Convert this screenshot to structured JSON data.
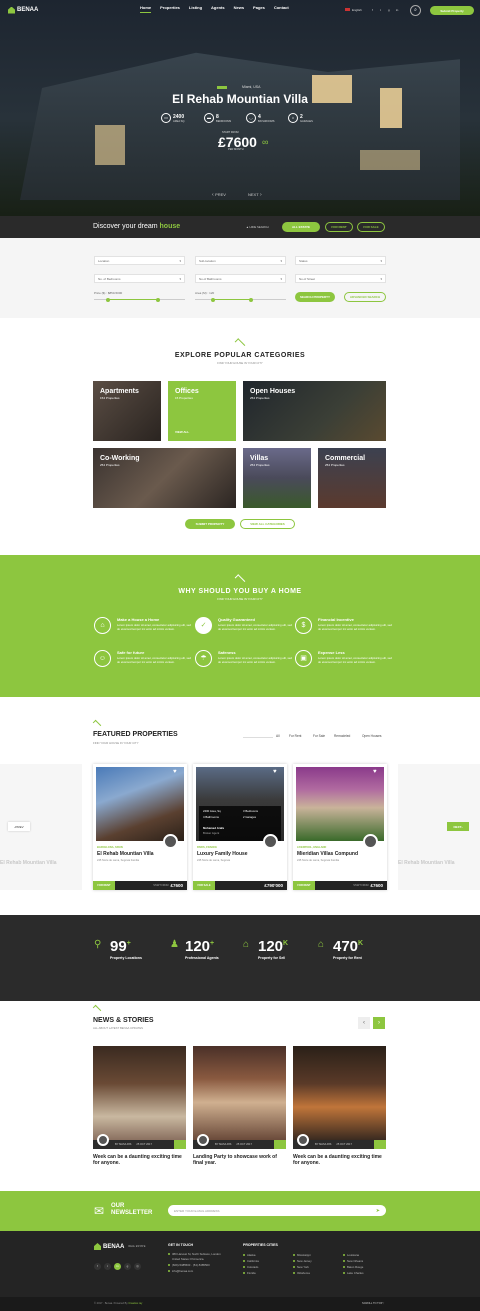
{
  "brand": {
    "name": "BENAA",
    "tagline": "REAL ESTATE"
  },
  "nav": {
    "items": [
      "Home",
      "Properties",
      "Listing",
      "Agents",
      "News",
      "Pages",
      "Contact"
    ],
    "language": "English",
    "submit": "Submit Property"
  },
  "hero": {
    "location": "Miami, USA",
    "title": "El Rehab Mountian Villa",
    "stats": [
      {
        "value": "2400",
        "label": "AREA SQ."
      },
      {
        "value": "8",
        "label": "BEDROOMS"
      },
      {
        "value": "4",
        "label": "BATHROOMS"
      },
      {
        "value": "2",
        "label": "GARAGES"
      }
    ],
    "from_label": "START FROM",
    "price": "£7600",
    "per": "PER MONTH",
    "prev": "PREV",
    "next": "NEXT"
  },
  "discover": {
    "text": "Discover your dream ",
    "highlight": "house",
    "hide": "HIDE SEARCH",
    "buttons": [
      "ALL ESTATE",
      "FOR RENT",
      "FOR SALE"
    ]
  },
  "search": {
    "fields": [
      "Location",
      "Sub-location",
      "Status",
      "No. of Bedrooms",
      "No.of Bathrooms",
      "No.of Street"
    ],
    "price_label": "Price ($) : $850-5000",
    "area_label": "Area (M) : 120",
    "search_btn": "SEARCH PROPERTY",
    "advanced_btn": "ADVANCED SEARCH"
  },
  "categories": {
    "title": "EXPLORE POPULAR CATEGORIES",
    "subtitle": "FIND YOUR HOUSE IN YOUR CITY",
    "items": [
      {
        "name": "Apartments",
        "count": "154 Properties"
      },
      {
        "name": "Offices",
        "count": "15 Properties",
        "more": "VIEW ALL"
      },
      {
        "name": "Open Houses",
        "count": "254 Properties"
      },
      {
        "name": "Co-Working",
        "count": "254 Properties"
      },
      {
        "name": "Villas",
        "count": "254 Properties"
      },
      {
        "name": "Commercial",
        "count": "254 Properties"
      }
    ],
    "buttons": [
      "SUBMIT PROPERTY",
      "VIEW ALL CATEGORIES"
    ]
  },
  "why": {
    "title": "WHY SHOULD YOU BUY A HOME",
    "subtitle": "FIND YOUR HOUSE IN YOUR CITY",
    "desc": "Lorem ipsum dolor sit amet, consectetur adipisicing elit, sed do eiusmod tempor inc enim ad minim veniam.",
    "items": [
      "Make a House a Home",
      "Quality Guaranteed",
      "Financial Incentive",
      "Safe for future",
      "Safeness",
      "Expense Less"
    ]
  },
  "featured": {
    "title": "FEATURED PROPERTIES",
    "subtitle": "FIND YOUR HOUSE IN YOUR CITY",
    "tabs": [
      "All",
      "For Rent",
      "For Sale",
      "Remodeled",
      "Open Houses"
    ],
    "prev": "PREV",
    "next": "NEXT",
    "cards": [
      {
        "loc": "BARCELONA, SPAIN",
        "name": "El Rehab Mountian Villa",
        "addr": "245 Norte de Lama, Segovia Familia",
        "type": "FOR RENT",
        "start": "START FROM",
        "price": "£7600"
      },
      {
        "loc": "PARIS, FRANCE",
        "name": "Luxury Family House",
        "addr": "245 Norte de Lama, Segovia",
        "type": "FOR SALE",
        "price": "£790'000",
        "area": "2400 Area, Sq",
        "beds": "3 Bedrooms",
        "baths": "4 Bathrooms",
        "garages": "2 Garages",
        "agent": "Mohamed Arafa",
        "agent_role": "Broker Agent"
      },
      {
        "loc": "LIVERPOOL, ENGLAND",
        "name": "Mieridian Villas Compund",
        "addr": "245 Norte de Lama, Segovia Familia",
        "type": "FOR RENT",
        "start": "START FROM",
        "price": "£7600"
      }
    ],
    "ghost_left": "El Rehab Mountian Villa",
    "ghost_right": "El Rehab Mountian Villa"
  },
  "counters": [
    {
      "n": "99",
      "sup": "+",
      "l": "Property Locations"
    },
    {
      "n": "120",
      "sup": "+",
      "l": "Professional Agents"
    },
    {
      "n": "120",
      "sup": "K",
      "l": "Property for Sell"
    },
    {
      "n": "470",
      "sup": "K",
      "l": "Property for Rent"
    }
  ],
  "news": {
    "title": "NEWS & STORIES",
    "subtitle": "ALL ABOUT LATEST BENAA UPDATES",
    "items": [
      {
        "by": "BY MASA RIS",
        "date": "25 OCT 2017",
        "title": "Week can be a daunting exciting time for anyone."
      },
      {
        "by": "BY MASA RIS",
        "date": "25 OCT 2017",
        "title": "Landing Party to showcase work of final year."
      },
      {
        "by": "BY MASA RIS",
        "date": "25 OCT 2017",
        "title": "Week can be a daunting exciting time for anyone."
      }
    ]
  },
  "newsletter": {
    "title": "OUR",
    "title2": "NEWSLETTER",
    "placeholder": "ENTER YOUR E-MAIL ADDRESS"
  },
  "footer": {
    "get_in_touch": "GET IN TOUCH",
    "address1": "380 Harvest St, North Subiaco, London",
    "address2": "United States Of America.",
    "phone": "(609)-5485500 · (54)-5485500",
    "email": "info@benaa.com",
    "cities_title": "PROPERTIES CITIES",
    "cities": [
      "Alaska",
      "California",
      "Colorado",
      "Florida",
      "Mississippi",
      "New Jersey",
      "New York",
      "Oklahoma",
      "Louisiana",
      "New Orleans",
      "Baton Rouge",
      "Lake Charles"
    ],
    "copyright": "© 2017 · Benaa. Powered By ",
    "creator": "Creative ray",
    "back": "SCROLL TO TOP"
  }
}
